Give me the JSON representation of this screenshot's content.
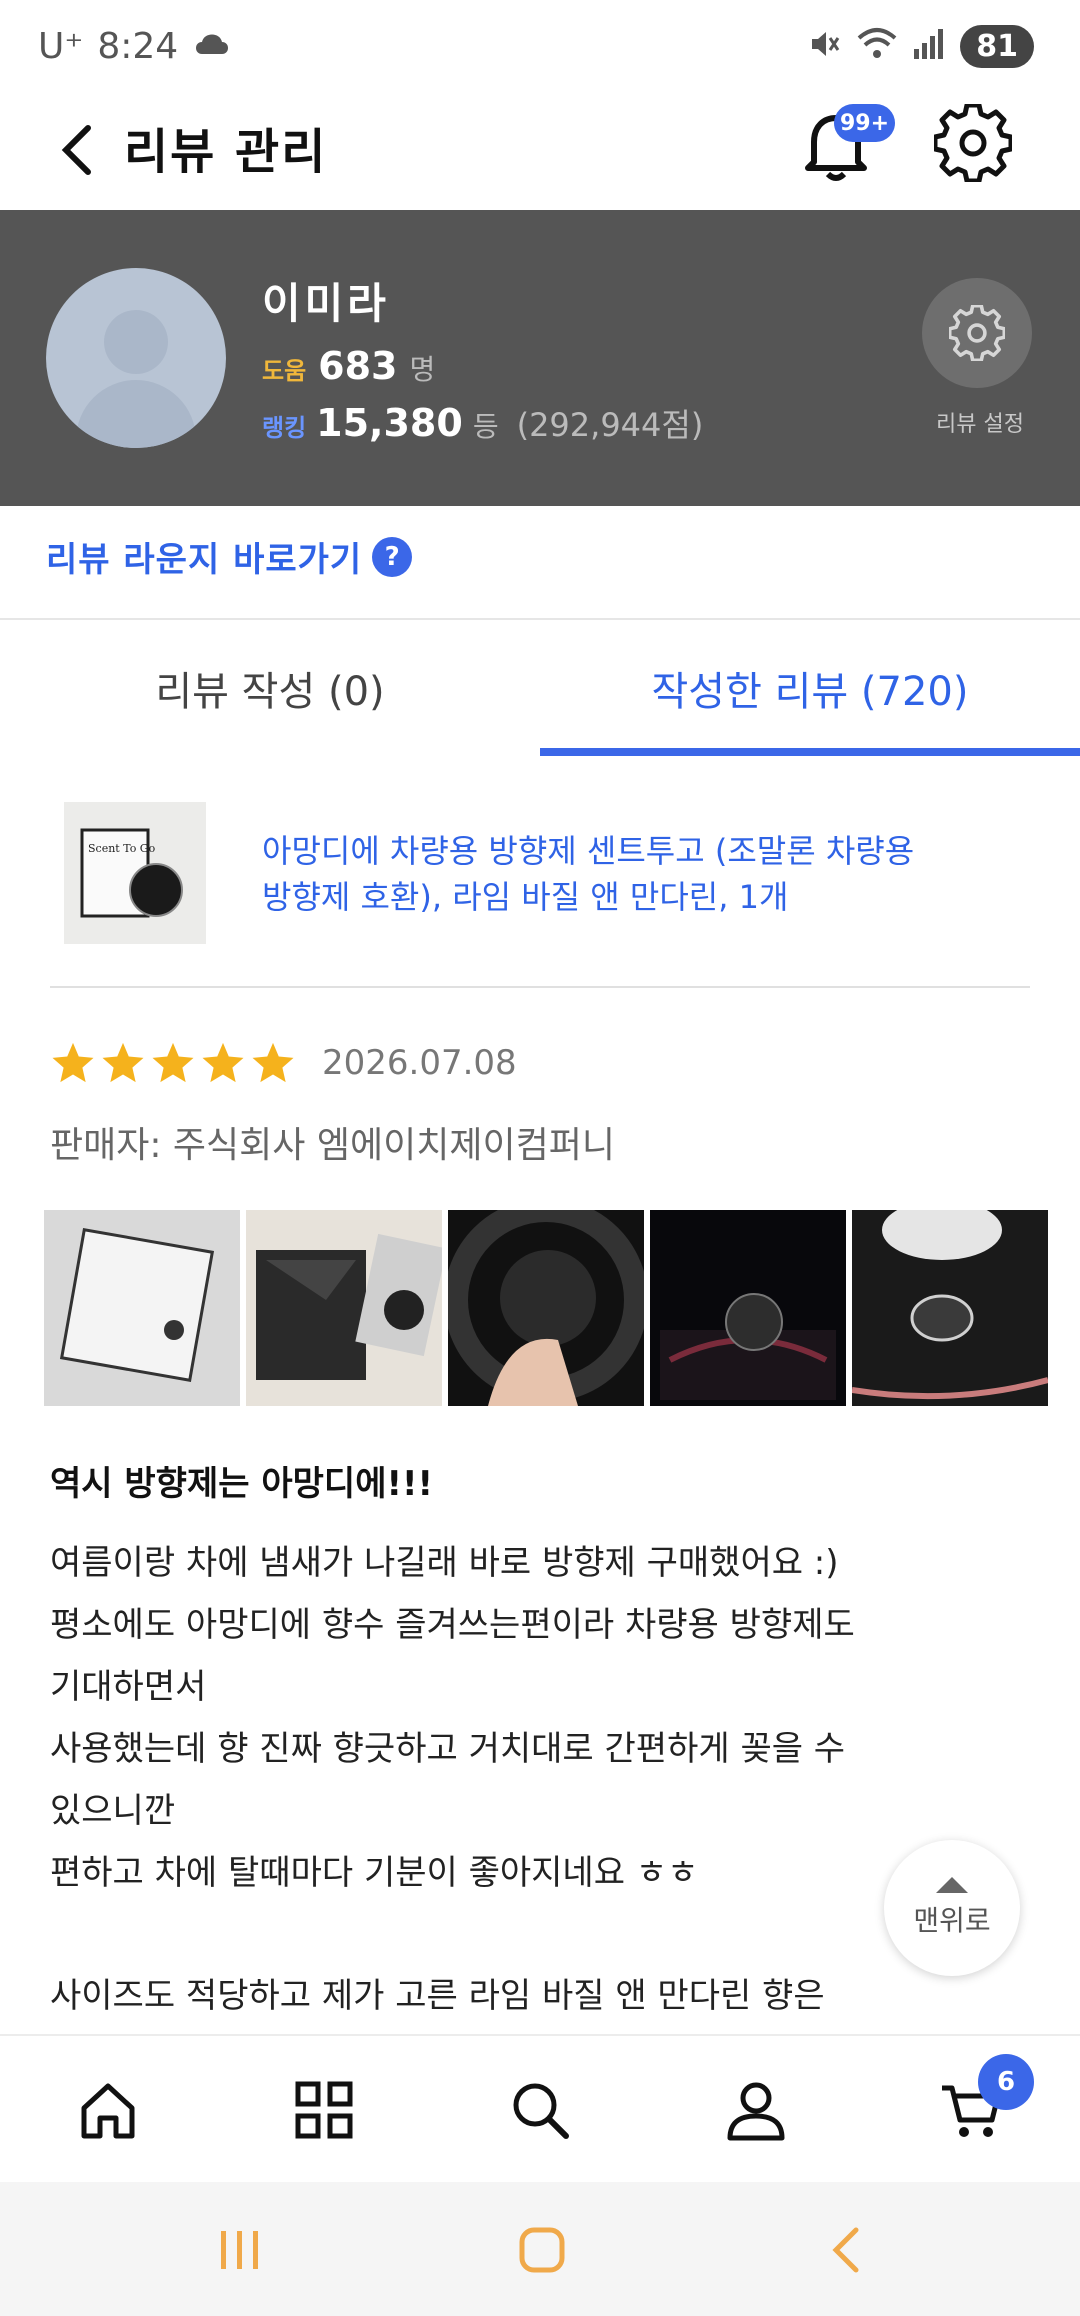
{
  "status_bar": {
    "carrier": "U⁺",
    "time": "8:24",
    "battery": "81"
  },
  "header": {
    "title": "리뷰 관리",
    "notification_badge": "99+"
  },
  "profile": {
    "name": "이미라",
    "help_label": "도움",
    "help_count": "683",
    "help_unit": "명",
    "rank_label": "랭킹",
    "rank_value": "15,380",
    "rank_unit": "등",
    "points": "(292,944점)",
    "review_settings_label": "리뷰 설정"
  },
  "lounge": {
    "label": "리뷰 라운지 바로가기",
    "help_glyph": "?"
  },
  "tabs": [
    {
      "label": "리뷰 작성 (0)",
      "active": false
    },
    {
      "label": "작성한 리뷰 (720)",
      "active": true
    }
  ],
  "product": {
    "title_line1": "아망디에 차량용 방향제 센트투고 (조말론 차량용",
    "title_line2": "방향제 호환), 라임 바질 앤 만다린, 1개",
    "thumb_text": "Scent To Go"
  },
  "review": {
    "rating": 5,
    "date": "2026.07.08",
    "seller": "판매자: 주식회사 엠에이치제이컴퍼니",
    "photo_count_visible": 5,
    "headline": "역시 방향제는 아망디에!!!",
    "body_lines": [
      "여름이랑 차에 냄새가 나길래 바로 방향제 구매했어요 :)",
      "평소에도 아망디에 향수 즐겨쓰는편이라 차량용 방향제도",
      "기대하면서",
      "사용했는데 향 진짜 향긋하고 거치대로 간편하게 꽂을 수",
      "있으니깐",
      "편하고 차에 탈때마다 기분이 좋아지네요 ㅎㅎ"
    ],
    "more_line": "사이즈도 적당하고 제가 고른 라임 바질 앤 만다린 향은"
  },
  "scroll_top": {
    "label": "맨위로"
  },
  "bottom_nav": {
    "cart_badge": "6"
  },
  "colors": {
    "accent": "#3b67e8",
    "profile_bg": "#555555",
    "star": "#f5b21c"
  }
}
